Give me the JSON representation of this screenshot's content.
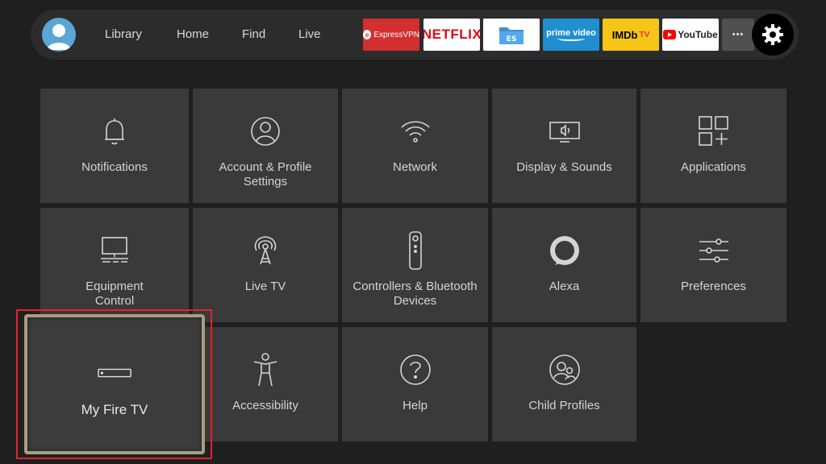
{
  "topbar": {
    "nav": [
      "Library",
      "Home",
      "Find",
      "Live"
    ],
    "apps": {
      "expressvpn": "ExpressVPN",
      "netflix": "NETFLIX",
      "prime_top": "prime video",
      "imdb": "IMDb",
      "imdb_tv": "TV",
      "youtube": "YouTube",
      "more": "•••"
    }
  },
  "tiles": [
    {
      "label": "Notifications",
      "icon": "bell-icon"
    },
    {
      "label": "Account & Profile Settings",
      "icon": "user-icon"
    },
    {
      "label": "Network",
      "icon": "wifi-icon"
    },
    {
      "label": "Display & Sounds",
      "icon": "display-sound-icon"
    },
    {
      "label": "Applications",
      "icon": "apps-grid-icon"
    },
    {
      "label": "Equipment Control",
      "icon": "monitor-icon"
    },
    {
      "label": "Live TV",
      "icon": "antenna-icon"
    },
    {
      "label": "Controllers & Bluetooth Devices",
      "icon": "remote-icon"
    },
    {
      "label": "Alexa",
      "icon": "alexa-icon"
    },
    {
      "label": "Preferences",
      "icon": "sliders-icon"
    },
    {
      "label": "My Fire TV",
      "icon": "fire-tv-stick-icon"
    },
    {
      "label": "Accessibility",
      "icon": "accessibility-icon"
    },
    {
      "label": "Help",
      "icon": "help-icon"
    },
    {
      "label": "Child Profiles",
      "icon": "child-profiles-icon"
    }
  ],
  "colors": {
    "background": "#1f1f1f",
    "tile": "#3a3a3a",
    "selected_border": "#a89d82",
    "annotation": "#e0242c"
  }
}
